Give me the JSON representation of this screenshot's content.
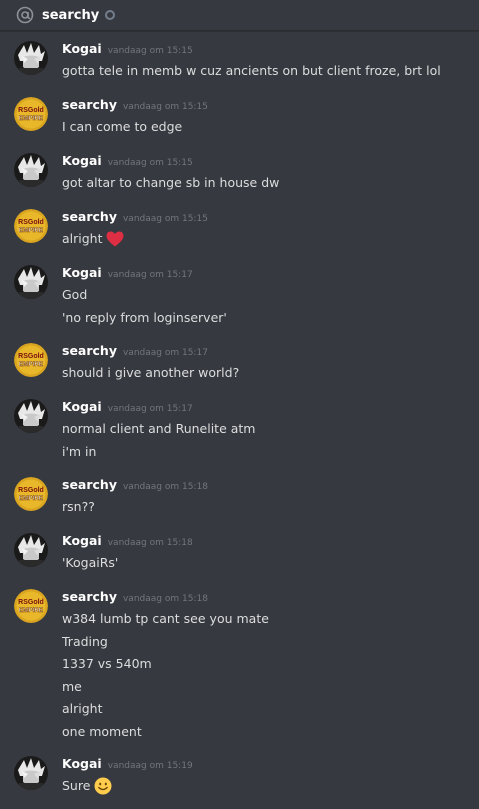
{
  "header": {
    "title": "searchy"
  },
  "avatars": {
    "kogai_icon": "anime-avatar-icon",
    "searchy_icon": "rsgold-empire-logo-icon",
    "searchy_logo_text_top": "RSGold",
    "searchy_logo_text_bottom": "EMPIRE"
  },
  "colors": {
    "background": "#36393f",
    "username": "#ffffff",
    "timestamp": "#72767d",
    "text": "#dcddde",
    "heart": "#dd2e44",
    "smile": "#ffcc4d"
  },
  "messages": [
    {
      "author": "Kogai",
      "time": "vandaag om 15:15",
      "lines": [
        "gotta tele in memb w cuz ancients on but client froze, brt lol"
      ]
    },
    {
      "author": "searchy",
      "time": "vandaag om 15:15",
      "lines": [
        "I can come to edge"
      ]
    },
    {
      "author": "Kogai",
      "time": "vandaag om 15:15",
      "lines": [
        "got altar to change sb in house dw"
      ]
    },
    {
      "author": "searchy",
      "time": "vandaag om 15:15",
      "lines": [
        "alright"
      ]
    },
    {
      "author": "Kogai",
      "time": "vandaag om 15:17",
      "lines": [
        "God",
        "'no reply from loginserver'"
      ]
    },
    {
      "author": "searchy",
      "time": "vandaag om 15:17",
      "lines": [
        "should i give another world?"
      ]
    },
    {
      "author": "Kogai",
      "time": "vandaag om 15:17",
      "lines": [
        "normal client and Runelite atm",
        "i'm in"
      ]
    },
    {
      "author": "searchy",
      "time": "vandaag om 15:18",
      "lines": [
        "rsn??"
      ]
    },
    {
      "author": "Kogai",
      "time": "vandaag om 15:18",
      "lines": [
        "'KogaiRs'"
      ]
    },
    {
      "author": "searchy",
      "time": "vandaag om 15:18",
      "lines": [
        "w384 lumb tp cant see you mate",
        "Trading",
        "1337 vs 540m",
        "me",
        "alright",
        "one moment"
      ]
    },
    {
      "author": "Kogai",
      "time": "vandaag om 15:19",
      "lines": [
        "Sure"
      ]
    }
  ]
}
